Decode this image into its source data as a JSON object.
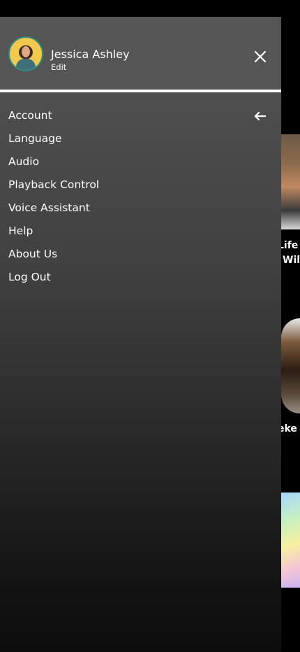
{
  "user": {
    "name": "Jessica Ashley",
    "edit_label": "Edit"
  },
  "menu": {
    "items": [
      {
        "label": "Account"
      },
      {
        "label": "Language"
      },
      {
        "label": "Audio"
      },
      {
        "label": "Playback Control"
      },
      {
        "label": "Voice Assistant"
      },
      {
        "label": "Help"
      },
      {
        "label": "About Us"
      },
      {
        "label": "Log Out"
      }
    ]
  },
  "background": {
    "card_1_title_line_1": "Life /",
    "card_1_title_line_2": "Wil",
    "card_2_title": "eke"
  },
  "icons": {
    "close": "close-icon",
    "back": "arrow-left-icon",
    "avatar": "avatar"
  },
  "colors": {
    "drawer_header": "#555555",
    "drawer_bottom": "#0d0d0d",
    "text": "#ffffff",
    "avatar_ring": "#2f8a86",
    "avatar_bg": "#f2c94c"
  }
}
